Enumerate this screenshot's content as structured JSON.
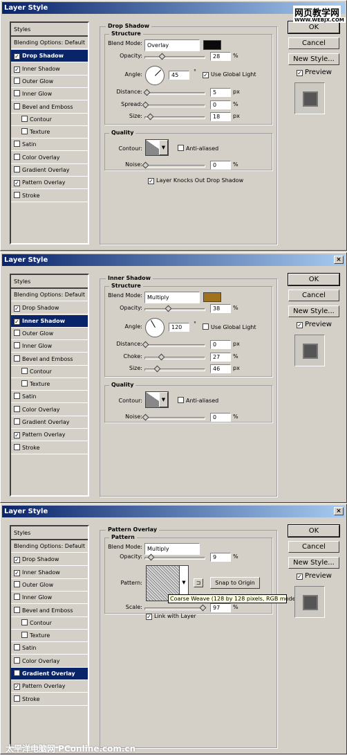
{
  "dialogs": [
    {
      "title": "Layer Style",
      "selected": 2,
      "panel_title": "Drop Shadow",
      "section": "Structure",
      "blend_mode": "Overlay",
      "color": "#0a0a0a",
      "opacity": {
        "label": "Opacity:",
        "value": "28",
        "unit": "%",
        "fraction": 0.28
      },
      "angle": {
        "label": "Angle:",
        "value": "45",
        "unit": "°",
        "degrees": 45,
        "global_light_label": "Use Global Light",
        "global_light": true
      },
      "sliders": [
        {
          "label": "Distance:",
          "value": "5",
          "unit": "px",
          "fraction": 0.02
        },
        {
          "label": "Spread:",
          "value": "0",
          "unit": "%",
          "fraction": 0
        },
        {
          "label": "Size:",
          "value": "18",
          "unit": "px",
          "fraction": 0.08
        }
      ],
      "quality": {
        "title": "Quality",
        "contour_label": "Contour:",
        "anti_aliased_label": "Anti-aliased",
        "anti_aliased": false,
        "noise": {
          "label": "Noise:",
          "value": "0",
          "unit": "%",
          "fraction": 0
        }
      },
      "extra_checkbox": {
        "label": "Layer Knocks Out Drop Shadow",
        "checked": true
      },
      "checks": [
        true,
        true,
        false,
        false,
        false,
        false,
        false,
        false,
        false,
        false,
        true,
        false
      ]
    },
    {
      "title": "Layer Style",
      "selected": 3,
      "panel_title": "Inner Shadow",
      "section": "Structure",
      "blend_mode": "Multiply",
      "color": "#a0721e",
      "opacity": {
        "label": "Opacity:",
        "value": "38",
        "unit": "%",
        "fraction": 0.38
      },
      "angle": {
        "label": "Angle:",
        "value": "120",
        "unit": "°",
        "degrees": 120,
        "global_light_label": "Use Global Light",
        "global_light": false
      },
      "sliders": [
        {
          "label": "Distance:",
          "value": "0",
          "unit": "px",
          "fraction": 0
        },
        {
          "label": "Choke:",
          "value": "27",
          "unit": "%",
          "fraction": 0.27
        },
        {
          "label": "Size:",
          "value": "46",
          "unit": "px",
          "fraction": 0.2
        }
      ],
      "quality": {
        "title": "Quality",
        "contour_label": "Contour:",
        "anti_aliased_label": "Anti-aliased",
        "anti_aliased": false,
        "noise": {
          "label": "Noise:",
          "value": "0",
          "unit": "%",
          "fraction": 0
        }
      },
      "checks": [
        true,
        true,
        false,
        false,
        false,
        false,
        false,
        false,
        false,
        false,
        true,
        false
      ]
    },
    {
      "title": "Layer Style",
      "selected": 11,
      "panel_title": "Pattern Overlay",
      "section": "Pattern",
      "blend_mode": "Multiply",
      "opacity": {
        "label": "Opacity:",
        "value": "9",
        "unit": "%",
        "fraction": 0.09
      },
      "pattern": {
        "label": "Pattern:",
        "snap_label": "Snap to Origin",
        "tooltip": "Coarse Weave (128 by 128 pixels, RGB mode)"
      },
      "scale": {
        "label": "Scale:",
        "value": "97",
        "unit": "%",
        "fraction": 0.97
      },
      "link": {
        "label": "Link with Layer",
        "checked": true
      },
      "checks": [
        true,
        true,
        false,
        false,
        false,
        false,
        false,
        false,
        false,
        false,
        true,
        false
      ]
    }
  ],
  "styles_list": [
    "Styles",
    "Blending Options: Default",
    "Drop Shadow",
    "Inner Shadow",
    "Outer Glow",
    "Inner Glow",
    "Bevel and Emboss",
    "Contour",
    "Texture",
    "Satin",
    "Color Overlay",
    "Gradient Overlay",
    "Pattern Overlay",
    "Stroke"
  ],
  "buttons": {
    "ok": "OK",
    "cancel": "Cancel",
    "new_style": "New Style...",
    "preview": "Preview"
  },
  "blend_label": "Blend Mode:",
  "close_glyph": "×",
  "watermarks": {
    "top": "网页教学网",
    "top_sub": "WWW.WEBJX.COM",
    "bottom": "太平洋电脑网 PConline.com.cn"
  }
}
